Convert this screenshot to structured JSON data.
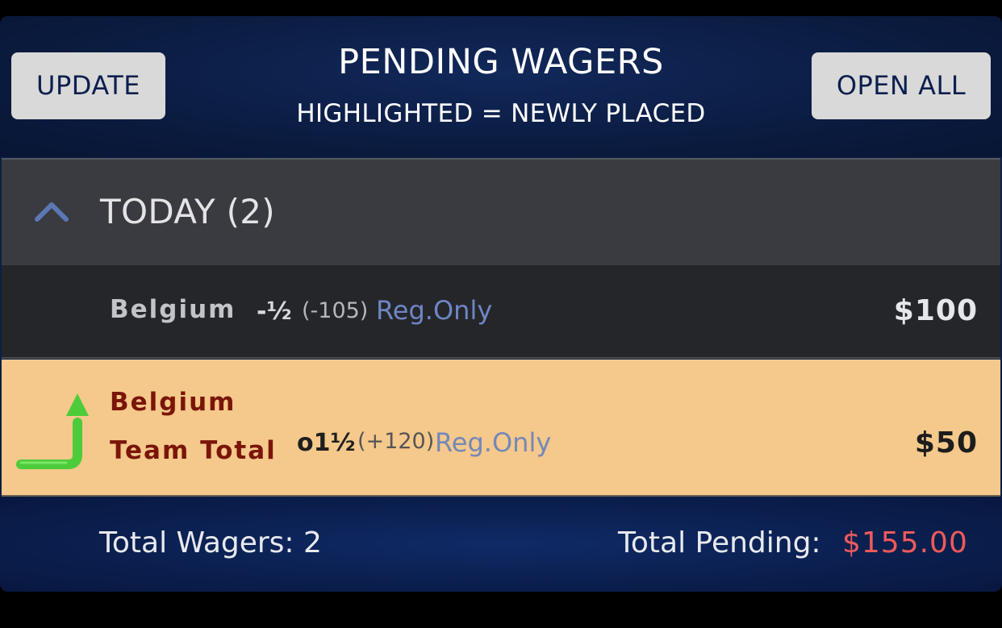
{
  "header": {
    "update_label": "UPDATE",
    "title": "PENDING WAGERS",
    "subtitle": "HIGHLIGHTED = NEWLY PLACED",
    "open_all_label": "OPEN ALL"
  },
  "section": {
    "title": "TODAY (2)",
    "toggle_icon": "chevron-up-icon"
  },
  "wagers": [
    {
      "team": "Belgium",
      "team_line2": "",
      "line": "-½",
      "odds": "(-105)",
      "rule": "Reg.Only",
      "amount": "$100",
      "highlighted": false
    },
    {
      "team": "Belgium",
      "team_line2": "Team Total",
      "line": "o1½",
      "odds": "(+120)",
      "rule": "Reg.Only",
      "amount": "$50",
      "highlighted": true,
      "icon": "new-wager-arrow-icon"
    }
  ],
  "footer": {
    "total_wagers_label": "Total Wagers:",
    "total_wagers_value": "2",
    "total_pending_label": "Total Pending:",
    "total_pending_value": "$155.00"
  },
  "colors": {
    "highlight": "#f5c88b",
    "accent_red": "#f05a5a",
    "arrow_green": "#4ccc3a"
  }
}
